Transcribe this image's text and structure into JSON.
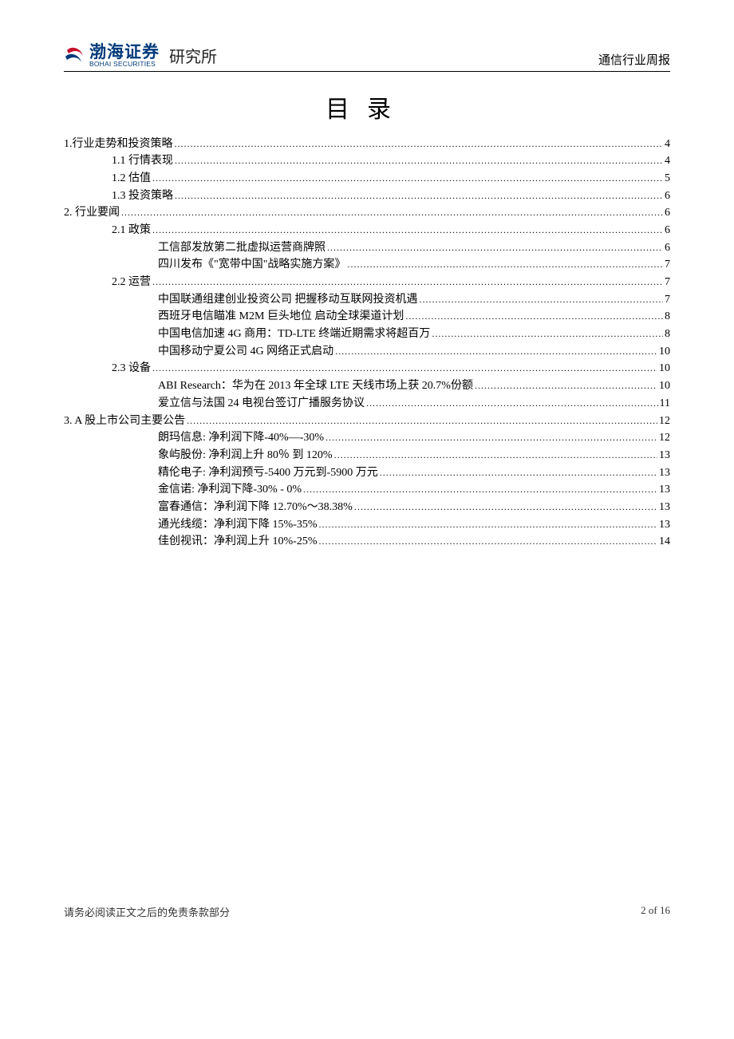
{
  "header": {
    "company_cn": "渤海证券",
    "company_en": "BOHAI SECURITIES",
    "department": "研究所",
    "report_type": "通信行业周报"
  },
  "title": "目录",
  "toc": [
    {
      "level": 0,
      "label": "1.行业走势和投资策略",
      "page": "4"
    },
    {
      "level": 1,
      "label": "1.1 行情表现",
      "page": "4"
    },
    {
      "level": 1,
      "label": "1.2 估值",
      "page": "5"
    },
    {
      "level": 1,
      "label": "1.3 投资策略",
      "page": "6"
    },
    {
      "level": 0,
      "label": "2. 行业要闻",
      "page": "6"
    },
    {
      "level": 1,
      "label": "2.1 政策",
      "page": "6"
    },
    {
      "level": 2,
      "label": "工信部发放第二批虚拟运营商牌照",
      "page": "6"
    },
    {
      "level": 2,
      "label": "四川发布《\"宽带中国\"战略实施方案》",
      "page": "7"
    },
    {
      "level": 1,
      "label": "2.2 运营",
      "page": "7"
    },
    {
      "level": 2,
      "label": "中国联通组建创业投资公司 把握移动互联网投资机遇",
      "page": "7"
    },
    {
      "level": 2,
      "label": "西班牙电信瞄准 M2M 巨头地位 启动全球渠道计划",
      "page": "8"
    },
    {
      "level": 2,
      "label": "中国电信加速 4G 商用：TD-LTE 终端近期需求将超百万",
      "page": "8"
    },
    {
      "level": 2,
      "label": "中国移动宁夏公司 4G 网络正式启动",
      "page": "10"
    },
    {
      "level": 1,
      "label": "2.3 设备",
      "page": "10"
    },
    {
      "level": 2,
      "label": "ABI Research：华为在 2013 年全球 LTE 天线市场上获 20.7%份额",
      "page": "10"
    },
    {
      "level": 2,
      "label": "爱立信与法国 24 电视台签订广播服务协议",
      "page": "11"
    },
    {
      "level": 0,
      "label": "3. A 股上市公司主要公告",
      "page": "12"
    },
    {
      "level": 2,
      "label": "朗玛信息: 净利润下降-40%—-30%",
      "page": "12"
    },
    {
      "level": 2,
      "label": "象屿股份: 净利润上升 80％ 到 120%",
      "page": "13"
    },
    {
      "level": 2,
      "label": "精伦电子: 净利润预亏-5400 万元到-5900 万元",
      "page": "13"
    },
    {
      "level": 2,
      "label": "金信诺: 净利润下降-30% - 0%",
      "page": "13"
    },
    {
      "level": 2,
      "label": "富春通信：净利润下降 12.70%～38.38%",
      "page": "13"
    },
    {
      "level": 2,
      "label": "通光线缆：净利润下降 15%-35%",
      "page": "13"
    },
    {
      "level": 2,
      "label": "佳创视讯：净利润上升 10%-25%",
      "page": "14"
    }
  ],
  "footer": {
    "disclaimer": "请务必阅读正文之后的免责条款部分",
    "pagination": "2 of 16"
  }
}
